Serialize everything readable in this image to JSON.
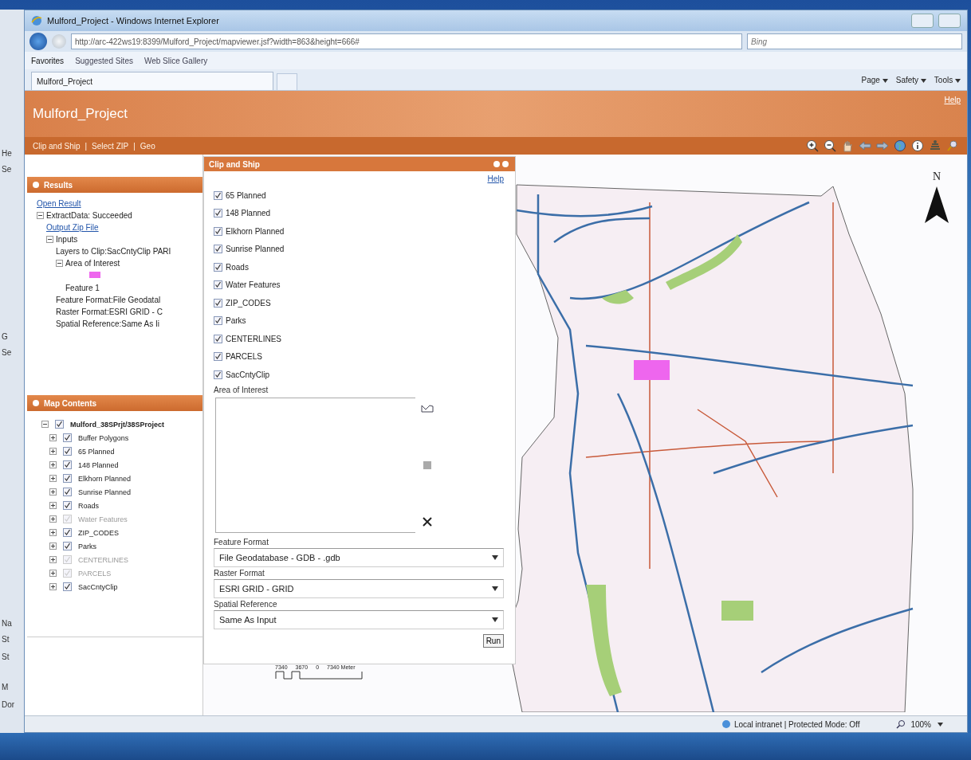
{
  "back_window": {
    "fragments": [
      "He",
      "Se",
      "G",
      "Se",
      "Na",
      "St",
      "St",
      "M",
      "Dor"
    ]
  },
  "browser": {
    "title": "Mulford_Project - Windows Internet Explorer",
    "address": "http://arc-422ws19:8399/Mulford_Project/mapviewer.jsf?width=863&height=666#",
    "search_placeholder": "Bing",
    "favorites_bar": [
      "Favorites",
      "Suggested Sites",
      "Web Slice Gallery"
    ],
    "tab": "Mulford_Project",
    "command_bar": [
      "Page",
      "Safety",
      "Tools"
    ]
  },
  "app": {
    "title": "Mulford_Project",
    "help": "Help",
    "nav_separator": "|",
    "nav": [
      "Clip and Ship",
      "Select ZIP",
      "Geo"
    ]
  },
  "results": {
    "title": "Results",
    "tree": [
      {
        "kind": "link",
        "text": "Open Result"
      },
      {
        "kind": "text",
        "text": "ExtractData: Succeeded",
        "expanded": true,
        "children": [
          {
            "kind": "link",
            "text": "Output Zip File"
          },
          {
            "kind": "text",
            "text": "Inputs",
            "expanded": true,
            "children": [
              {
                "kind": "text",
                "text": "Layers to Clip:SacCntyClip PARI"
              },
              {
                "kind": "text",
                "text": "Area of Interest",
                "expanded": true,
                "children": [
                  {
                    "kind": "swatch",
                    "color": "#ee66ee"
                  },
                  {
                    "kind": "text",
                    "text": "Feature 1"
                  }
                ]
              },
              {
                "kind": "text",
                "text": "Feature Format:File Geodatal"
              },
              {
                "kind": "text",
                "text": "Raster Format:ESRI GRID - C"
              },
              {
                "kind": "text",
                "text": "Spatial Reference:Same As Ii"
              }
            ]
          }
        ]
      }
    ]
  },
  "map_contents": {
    "title": "Map Contents",
    "root": {
      "text": "Mulford_38SPrjt/38SProject",
      "checked": true,
      "expanded": true,
      "children": [
        {
          "text": "Buffer Polygons",
          "checked": true,
          "disabled": false,
          "expanded": false
        },
        {
          "text": "65 Planned",
          "checked": true,
          "disabled": false,
          "expanded": false
        },
        {
          "text": "148 Planned",
          "checked": true,
          "disabled": false,
          "expanded": false
        },
        {
          "text": "Elkhorn Planned",
          "checked": true,
          "disabled": false,
          "expanded": false
        },
        {
          "text": "Sunrise Planned",
          "checked": true,
          "disabled": false,
          "expanded": false
        },
        {
          "text": "Roads",
          "checked": true,
          "disabled": false,
          "expanded": false
        },
        {
          "text": "Water Features",
          "checked": true,
          "disabled": true,
          "expanded": false
        },
        {
          "text": "ZIP_CODES",
          "checked": true,
          "disabled": false,
          "expanded": false
        },
        {
          "text": "Parks",
          "checked": true,
          "disabled": false,
          "expanded": false
        },
        {
          "text": "CENTERLINES",
          "checked": true,
          "disabled": true,
          "expanded": false
        },
        {
          "text": "PARCELS",
          "checked": true,
          "disabled": true,
          "expanded": false
        },
        {
          "text": "SacCntyClip",
          "checked": true,
          "disabled": false,
          "expanded": false
        }
      ]
    }
  },
  "dialog": {
    "title": "Clip and Ship",
    "help": "Help",
    "layers": [
      {
        "label": "65 Planned",
        "checked": true
      },
      {
        "label": "148 Planned",
        "checked": true
      },
      {
        "label": "Elkhorn Planned",
        "checked": true
      },
      {
        "label": "Sunrise Planned",
        "checked": true
      },
      {
        "label": "Roads",
        "checked": true
      },
      {
        "label": "Water Features",
        "checked": true
      },
      {
        "label": "ZIP_CODES",
        "checked": true
      },
      {
        "label": "Parks",
        "checked": true
      },
      {
        "label": "CENTERLINES",
        "checked": true
      },
      {
        "label": "PARCELS",
        "checked": true
      },
      {
        "label": "SacCntyClip",
        "checked": true
      }
    ],
    "aoi_label": "Area of Interest",
    "fields": [
      {
        "label": "Feature Format",
        "value": "File Geodatabase - GDB - .gdb"
      },
      {
        "label": "Raster Format",
        "value": "ESRI GRID - GRID"
      },
      {
        "label": "Spatial Reference",
        "value": "Same As Input"
      }
    ],
    "run": "Run"
  },
  "map": {
    "north": "N",
    "scale_labels": [
      "7340",
      "3670",
      "0",
      "7340 Meter"
    ]
  },
  "status_bar": {
    "zone": "Local intranet | Protected Mode: Off",
    "zoom": "100%"
  }
}
